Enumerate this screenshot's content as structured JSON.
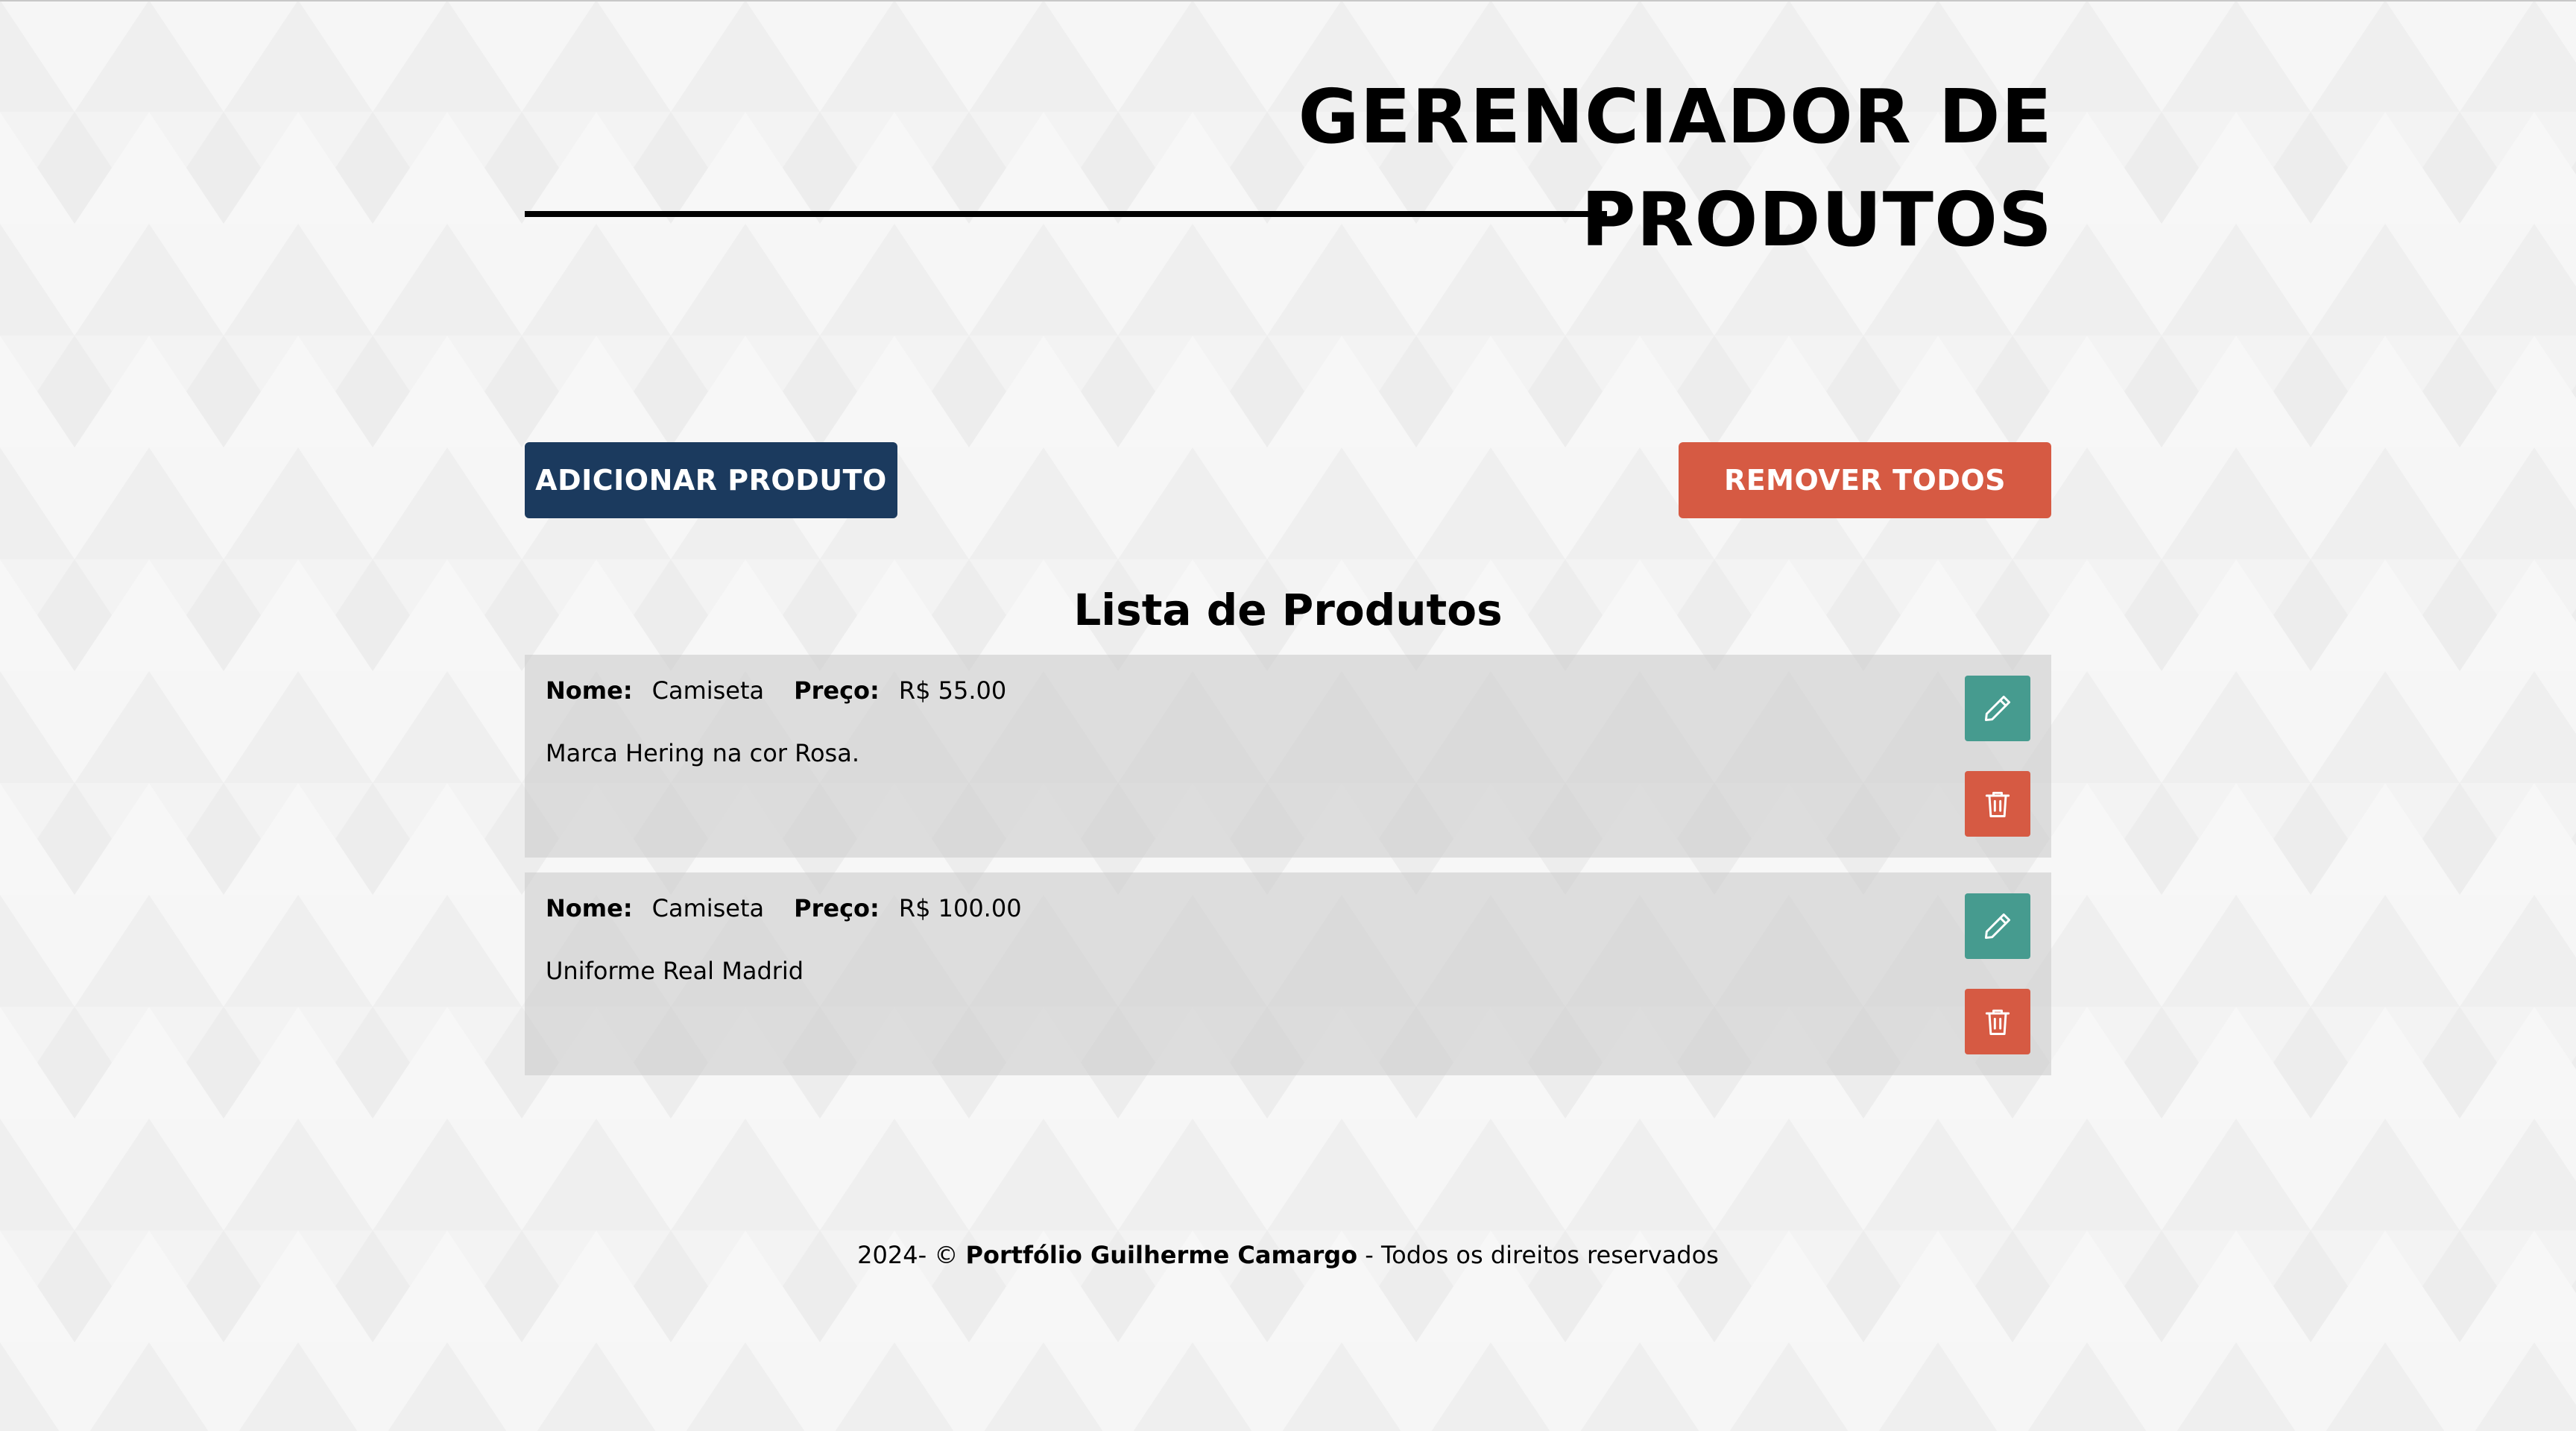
{
  "header": {
    "title_line1": "GERENCIADOR DE",
    "title_line2": "PRODUTOS"
  },
  "actions": {
    "add_label": "ADICIONAR PRODUTO",
    "remove_all_label": "REMOVER TODOS"
  },
  "list": {
    "title": "Lista de Produtos",
    "name_label": "Nome:",
    "price_label": "Preço:",
    "items": [
      {
        "name": "Camiseta",
        "price": "R$ 55.00",
        "description": "Marca Hering na cor Rosa.",
        "edit_icon": "pencil-icon",
        "delete_icon": "trash-icon"
      },
      {
        "name": "Camiseta",
        "price": "R$ 100.00",
        "description": "Uniforme Real Madrid",
        "edit_icon": "pencil-icon",
        "delete_icon": "trash-icon"
      }
    ]
  },
  "footer": {
    "prefix": "2024- ©",
    "owner": "Portfólio Guilherme Camargo",
    "suffix": "- Todos os direitos reservados"
  },
  "colors": {
    "add_button": "#1b3a5e",
    "danger": "#d65a43",
    "edit_button": "#469b8f",
    "card_background": "#d9d9d9",
    "page_background": "#f3f3f3"
  }
}
